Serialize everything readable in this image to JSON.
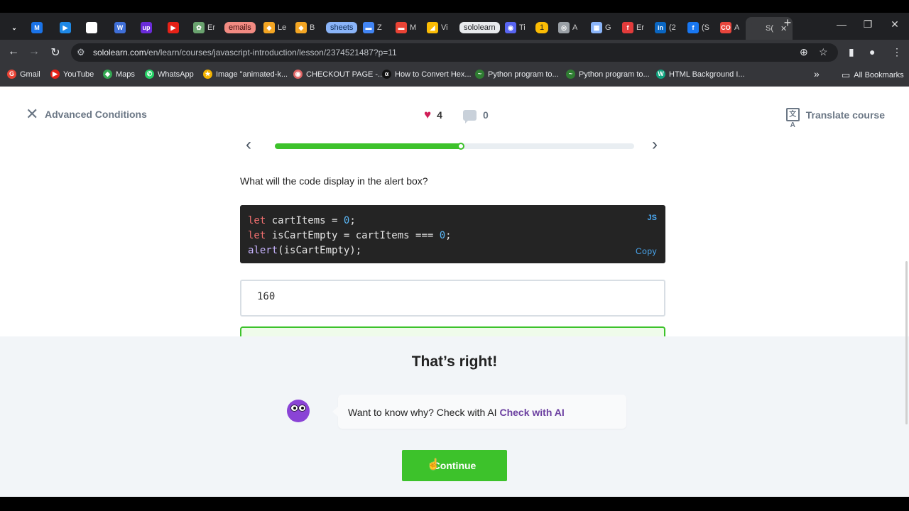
{
  "browser": {
    "tabs": [
      {
        "label": "",
        "fav_color": "#202124",
        "fav_text": "⌄"
      },
      {
        "label": "",
        "fav_color": "#1a73e8",
        "fav_text": "M"
      },
      {
        "label": "",
        "fav_color": "#1e88e5",
        "fav_text": "▶"
      },
      {
        "label": "",
        "fav_color": "#ffffff",
        "fav_text": "◎"
      },
      {
        "label": "",
        "fav_color": "#3f6fd8",
        "fav_text": "W"
      },
      {
        "label": "",
        "fav_color": "#6a2bd9",
        "fav_text": "up"
      },
      {
        "label": "",
        "fav_color": "#e62117",
        "fav_text": "▶"
      },
      {
        "label": "Er",
        "fav_color": "#6aa36f",
        "fav_text": "✿"
      },
      {
        "label": "emails",
        "pill_color": "#f28b82",
        "pill_text_color": "#3c0a0a"
      },
      {
        "label": "Le",
        "fav_color": "#f4a623",
        "fav_text": "◆"
      },
      {
        "label": "B",
        "fav_color": "#f4a623",
        "fav_text": "◆"
      },
      {
        "label": "sheets",
        "pill_color": "#8ab4f8",
        "pill_text_color": "#0b2a55"
      },
      {
        "label": "Z",
        "fav_color": "#4285f4",
        "fav_text": "▬"
      },
      {
        "label": "M",
        "fav_color": "#ea4335",
        "fav_text": "▬"
      },
      {
        "label": "Vi",
        "fav_color": "#fbbc04",
        "fav_text": "◢"
      },
      {
        "label": "sololearn",
        "pill_color": "#e8eaed",
        "pill_text_color": "#202124"
      },
      {
        "label": "Ti",
        "fav_color": "#5865f2",
        "fav_text": "◉"
      },
      {
        "label": "1",
        "pill_color": "#fbbc04",
        "pill_text_color": "#202124"
      },
      {
        "label": "A",
        "fav_color": "#9aa0a6",
        "fav_text": "◎"
      },
      {
        "label": "G",
        "fav_color": "#8ab4f8",
        "fav_text": "▦"
      },
      {
        "label": "Er",
        "fav_color": "#e23b3b",
        "fav_text": "f"
      },
      {
        "label": "(2",
        "fav_color": "#0a66c2",
        "fav_text": "in"
      },
      {
        "label": "(S",
        "fav_color": "#1877f2",
        "fav_text": "f"
      },
      {
        "label": "A",
        "fav_color": "#e8453c",
        "fav_text": "CO"
      },
      {
        "label": "S(",
        "fav_color": "#3a3b3e",
        "fav_text": ""
      }
    ],
    "active_tab_close": "✕",
    "new_tab": "+",
    "window_controls": {
      "minimize": "—",
      "maximize": "❐",
      "close": "✕"
    },
    "nav": {
      "back": "←",
      "forward": "→",
      "reload": "↻"
    },
    "url": {
      "host": "sololearn.com",
      "path": "/en/learn/courses/javascript-introduction/lesson/2374521487?p=11"
    },
    "toolbar_icons": {
      "zoom": "⊕",
      "star": "☆",
      "sidepanel": "▮",
      "profile": "●",
      "menu": "⋮"
    },
    "bookmarks": [
      {
        "label": "Gmail",
        "color": "#ea4335",
        "glyph": "G"
      },
      {
        "label": "YouTube",
        "color": "#e62117",
        "glyph": "▶"
      },
      {
        "label": "Maps",
        "color": "#34a853",
        "glyph": "◆"
      },
      {
        "label": "WhatsApp",
        "color": "#25d366",
        "glyph": "✆"
      },
      {
        "label": "Image \"animated-k...",
        "color": "#f4b400",
        "glyph": "★"
      },
      {
        "label": "CHECKOUT PAGE -...",
        "color": "#e06666",
        "glyph": "◉"
      },
      {
        "label": "How to Convert Hex...",
        "color": "#111111",
        "glyph": "α"
      },
      {
        "label": "Python program to...",
        "color": "#2f7d32",
        "glyph": "~"
      },
      {
        "label": "Python program to...",
        "color": "#2f7d32",
        "glyph": "~"
      },
      {
        "label": "HTML Background I...",
        "color": "#10a37f",
        "glyph": "W"
      }
    ],
    "bookmarks_more": "»",
    "all_bookmarks": "All Bookmarks"
  },
  "header": {
    "close_icon": "✕",
    "lesson_title": "Advanced Conditions",
    "likes": "4",
    "comments": "0",
    "translate_label": "Translate course",
    "translate_icon": "文A"
  },
  "progress": {
    "fraction": 0.52,
    "prev": "‹",
    "next": "›"
  },
  "question": "What will the code display in the alert box?",
  "code": {
    "lang": "JS",
    "copy_label": "Copy",
    "lines": [
      [
        {
          "t": "kw",
          "v": "let"
        },
        {
          "t": "",
          "v": " cartItems = "
        },
        {
          "t": "num",
          "v": "0"
        },
        {
          "t": "",
          "v": ";"
        }
      ],
      [
        {
          "t": "kw",
          "v": "let"
        },
        {
          "t": "",
          "v": " isCartEmpty = cartItems === "
        },
        {
          "t": "num",
          "v": "0"
        },
        {
          "t": "",
          "v": ";"
        }
      ],
      [
        {
          "t": "fn",
          "v": "alert"
        },
        {
          "t": "",
          "v": "(isCartEmpty);"
        }
      ]
    ]
  },
  "answer": {
    "value": "160"
  },
  "feedback": {
    "title": "That’s right!",
    "ai_text": "Want to know why? Check with AI ",
    "ai_link": "Check with AI",
    "continue_label": "Continue"
  },
  "colors": {
    "accent_green": "#3dc22b",
    "heart": "#d01e57",
    "ai_purple": "#6b3fa0",
    "code_bg": "#242424"
  }
}
